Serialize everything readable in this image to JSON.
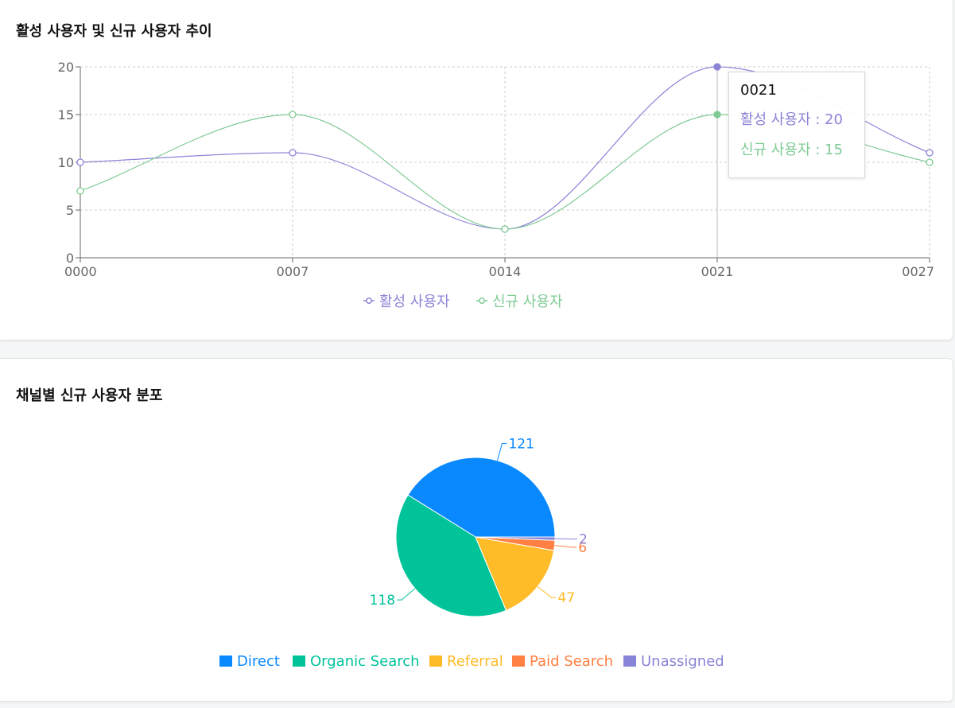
{
  "line_card": {
    "title": "활성 사용자 및 신규 사용자 추이",
    "tooltip": {
      "title": "0021",
      "rows": [
        {
          "label": "활성 사용자",
          "value": "20",
          "color": "#8b84d7"
        },
        {
          "label": "신규 사용자",
          "value": "15",
          "color": "#7fcb95"
        }
      ]
    }
  },
  "pie_card": {
    "title": "채널별 신규 사용자 분포"
  },
  "chart_data": [
    {
      "type": "line",
      "title": "활성 사용자 및 신규 사용자 추이",
      "x": [
        "0000",
        "0007",
        "0014",
        "0021",
        "0027"
      ],
      "ylim": [
        0,
        20
      ],
      "yticks": [
        0,
        5,
        10,
        15,
        20
      ],
      "grid": true,
      "smooth": true,
      "legend_position": "bottom-center",
      "highlighted_x": "0021",
      "series": [
        {
          "name": "활성 사용자",
          "values": [
            10,
            11,
            3,
            20,
            11
          ],
          "color": "#8b84d7"
        },
        {
          "name": "신규 사용자",
          "values": [
            7,
            15,
            3,
            15,
            10
          ],
          "color": "#7fcb95"
        }
      ]
    },
    {
      "type": "pie",
      "title": "채널별 신규 사용자 분포",
      "legend_position": "bottom-center",
      "categories": [
        "Direct",
        "Organic Search",
        "Referral",
        "Paid Search",
        "Unassigned"
      ],
      "values": [
        121,
        118,
        47,
        6,
        2
      ],
      "colors": [
        "#0a89ff",
        "#00c39a",
        "#ffbb28",
        "#ff8042",
        "#8884d8"
      ]
    }
  ]
}
